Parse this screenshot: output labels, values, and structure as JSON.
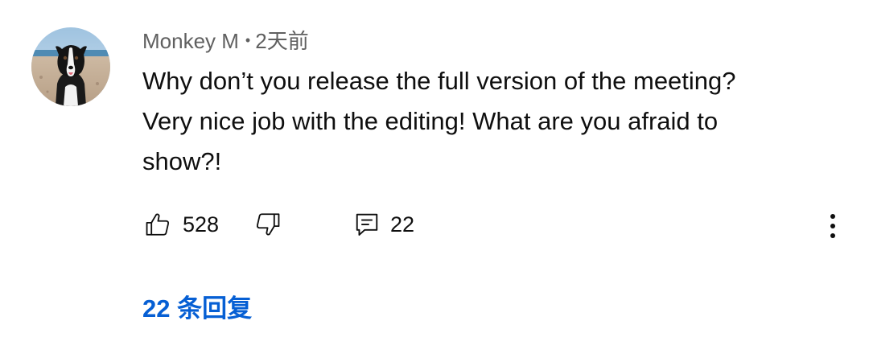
{
  "comment": {
    "author": "Monkey M",
    "separator": "•",
    "time": "2天前",
    "lines": [
      "Why don’t you release the full version of the meeting?",
      "Very nice job with the editing! What are you afraid to",
      "show?!"
    ],
    "likes": "528",
    "replies_count": "22",
    "replies_link": "22 条回复"
  },
  "icons": {
    "like": "thumbs-up-icon",
    "dislike": "thumbs-down-icon",
    "reply": "comment-icon",
    "more": "more-vertical-icon"
  },
  "colors": {
    "link": "#065fd4",
    "meta": "#606060",
    "text": "#0f0f0f"
  }
}
